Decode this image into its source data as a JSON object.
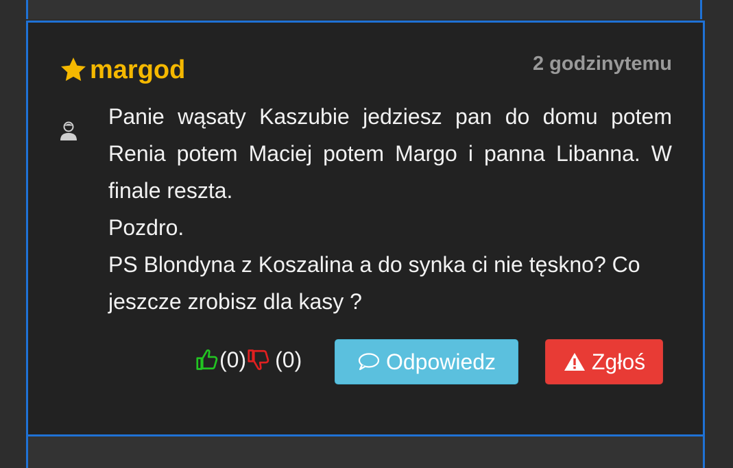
{
  "comment": {
    "author": "margod",
    "time": "2 godzinytemu",
    "paragraphs": [
      "Panie wąsaty Kaszubie jedziesz pan do domu potem Renia potem Maciej potem Margo i panna Libanna. W finale reszta.",
      "Pozdro.",
      "PS Blondyna z Koszalina a do synka ci nie tęskno? Co jeszcze zrobisz dla kasy ?"
    ],
    "likes": "(0)",
    "dislikes": "(0)",
    "reply_label": "Odpowiedz",
    "report_label": "Zgłoś"
  },
  "colors": {
    "author": "#f5b800",
    "accent_border": "#1f72d6",
    "reply_button": "#5bc0de",
    "report_button": "#e83b35",
    "like_icon": "#22c422",
    "dislike_icon": "#e02020"
  },
  "icons": {
    "author_badge": "star-icon",
    "avatar": "user-avatar-icon",
    "like": "thumbs-up-icon",
    "dislike": "thumbs-down-icon",
    "reply": "speech-bubble-icon",
    "report": "warning-icon"
  }
}
